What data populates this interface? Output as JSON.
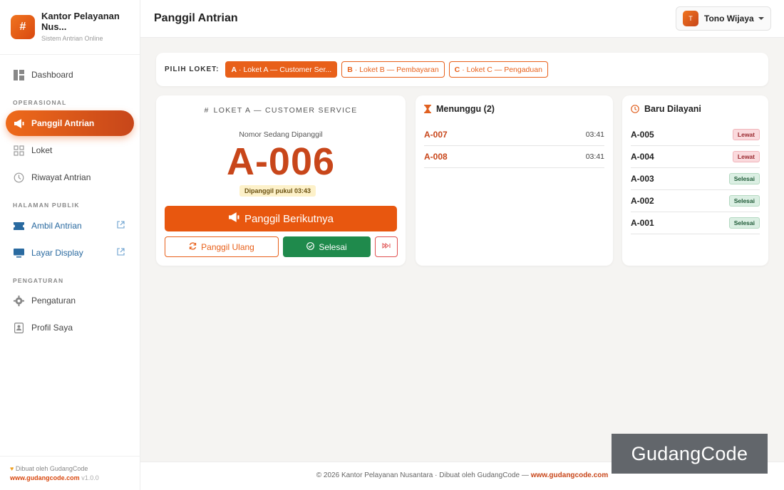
{
  "sidebar": {
    "brand_logo": "#",
    "brand_title": "Kantor Pelayanan Nus...",
    "brand_sub": "Sistem Antrian Online",
    "dashboard": "Dashboard",
    "section_operasional": "OPERASIONAL",
    "panggil": "Panggil Antrian",
    "loket": "Loket",
    "riwayat": "Riwayat Antrian",
    "section_publik": "HALAMAN PUBLIK",
    "ambil": "Ambil Antrian",
    "layar": "Layar Display",
    "section_pengaturan": "PENGATURAN",
    "pengaturan": "Pengaturan",
    "profil": "Profil Saya",
    "footer_made": "Dibuat oleh GudangCode",
    "footer_url": "www.gudangcode.com",
    "footer_version": "v1.0.0"
  },
  "topbar": {
    "title": "Panggil Antrian",
    "user_initial": "T",
    "user_name": "Tono Wijaya"
  },
  "picker": {
    "label": "PILIH LOKET:",
    "options": [
      {
        "code": "A",
        "label": "· Loket A — Customer Ser..."
      },
      {
        "code": "B",
        "label": "· Loket B — Pembayaran"
      },
      {
        "code": "C",
        "label": "· Loket C — Pengaduan"
      }
    ]
  },
  "current": {
    "hash": "#",
    "heading": "LOKET A — CUSTOMER SERVICE",
    "sub": "Nomor Sedang Dipanggil",
    "number": "A-006",
    "called_at": "Dipanggil pukul 03:43",
    "next_label": "Panggil Berikutnya",
    "recall_label": "Panggil Ulang",
    "done_label": "Selesai"
  },
  "waiting": {
    "title": "Menunggu (2)",
    "items": [
      {
        "number": "A-007",
        "time": "03:41"
      },
      {
        "number": "A-008",
        "time": "03:41"
      }
    ]
  },
  "served": {
    "title": "Baru Dilayani",
    "items": [
      {
        "number": "A-005",
        "status": "Lewat"
      },
      {
        "number": "A-004",
        "status": "Lewat"
      },
      {
        "number": "A-003",
        "status": "Selesai"
      },
      {
        "number": "A-002",
        "status": "Selesai"
      },
      {
        "number": "A-001",
        "status": "Selesai"
      }
    ]
  },
  "footer": {
    "text": "© 2026 Kantor Pelayanan Nusantara · Dibuat oleh GudangCode —",
    "url": "www.gudangcode.com"
  },
  "watermark": "GudangCode",
  "colors": {
    "accent": "#e8570f",
    "success": "#1f8a4c",
    "danger": "#e05050"
  }
}
